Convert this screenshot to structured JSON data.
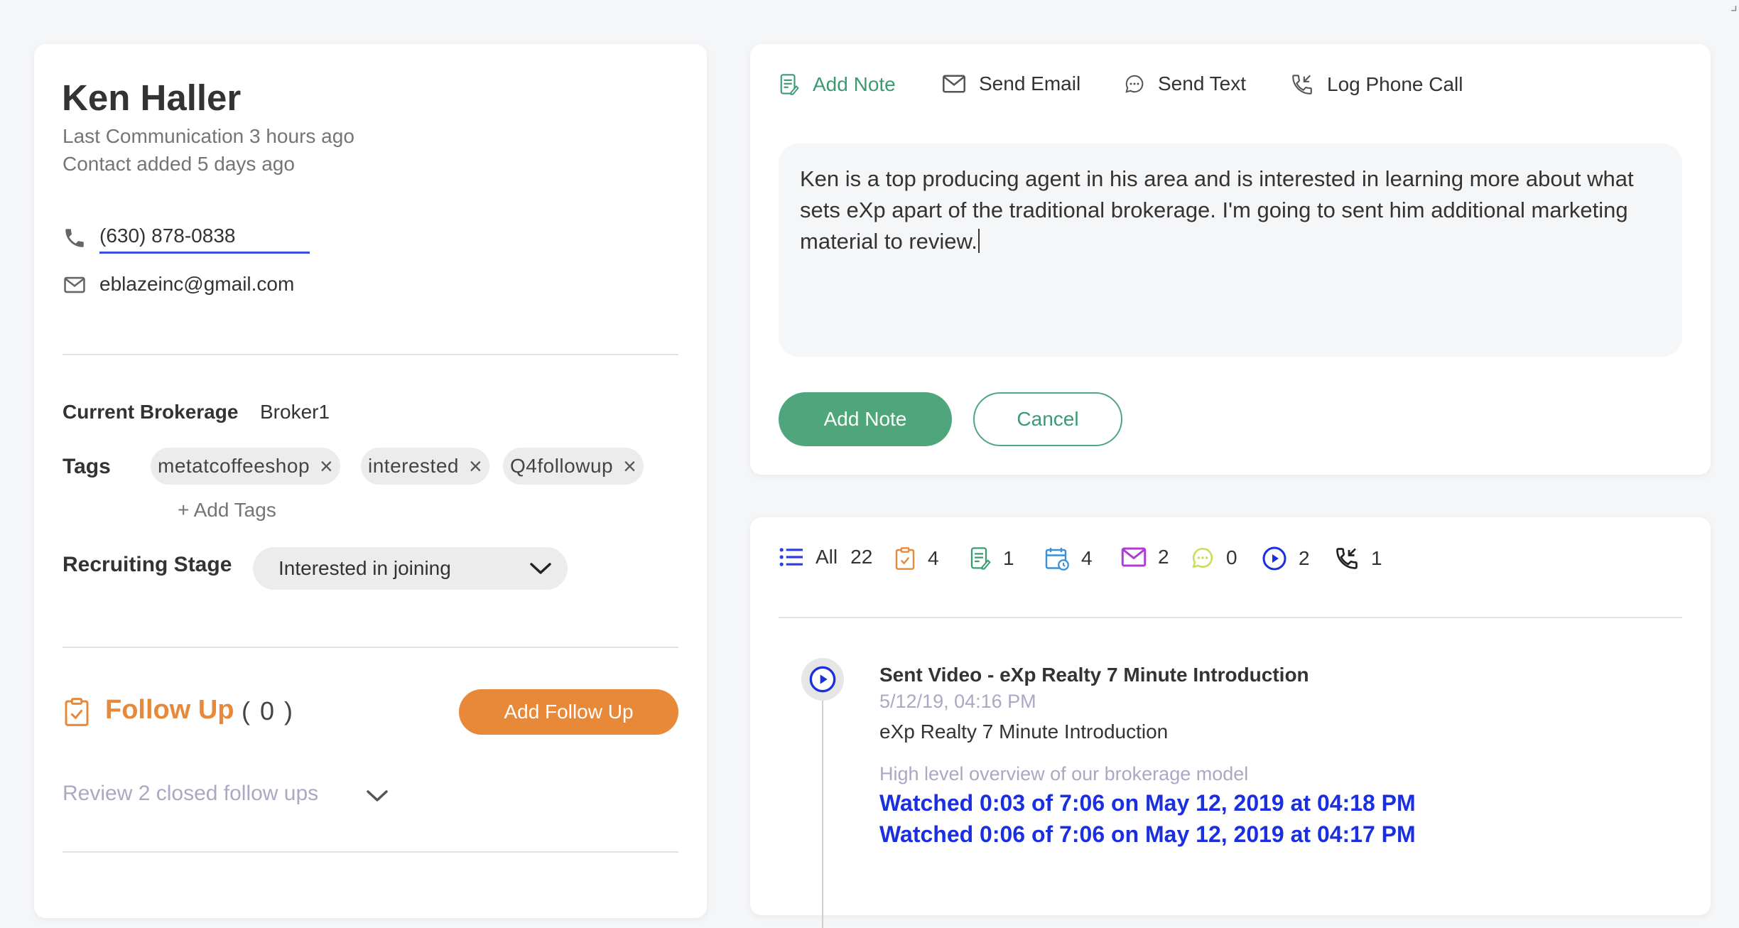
{
  "contact": {
    "name": "Ken Haller",
    "last_communication": "Last Communication 3 hours ago",
    "contact_added": "Contact added 5 days ago",
    "phone": "(630) 878-0838",
    "email": "eblazeinc@gmail.com"
  },
  "details": {
    "brokerage_label": "Current Brokerage",
    "brokerage_value": "Broker1",
    "tags_label": "Tags",
    "tags": [
      "metatcoffeeshop",
      "interested",
      "Q4followup"
    ],
    "tag_remove_glyph": "×",
    "add_tags": "+ Add Tags",
    "stage_label": "Recruiting Stage",
    "stage_value": "Interested in joining"
  },
  "follow_up": {
    "title": "Follow Up",
    "count": "( 0 )",
    "add_button": "Add Follow Up",
    "review": "Review 2 closed follow ups"
  },
  "composer": {
    "tabs": [
      {
        "label": "Add Note",
        "icon": "note-icon",
        "active": true
      },
      {
        "label": "Send Email",
        "icon": "email-icon",
        "active": false
      },
      {
        "label": "Send Text",
        "icon": "chat-bubble-icon",
        "active": false
      },
      {
        "label": "Log Phone Call",
        "icon": "phone-call-icon",
        "active": false
      }
    ],
    "note_text": "Ken is a top producing agent in his area and is interested in learning more about what sets eXp apart of the traditional brokerage. I'm going to sent him additional marketing material to review.",
    "add_button": "Add Note",
    "cancel_button": "Cancel"
  },
  "activity": {
    "filters": [
      {
        "icon": "list-icon",
        "label": "All",
        "count": "22",
        "color": "#2b3fe0"
      },
      {
        "icon": "clipboard-check-icon",
        "label": "",
        "count": "4",
        "color": "#e8893a"
      },
      {
        "icon": "note-icon",
        "label": "",
        "count": "1",
        "color": "#3a9b73"
      },
      {
        "icon": "calendar-clock-icon",
        "label": "",
        "count": "4",
        "color": "#3b8fd6"
      },
      {
        "icon": "envelope-icon",
        "label": "",
        "count": "2",
        "color": "#b03ad6"
      },
      {
        "icon": "chat-bubble-icon",
        "label": "",
        "count": "0",
        "color": "#cbdc5a"
      },
      {
        "icon": "play-circle-icon",
        "label": "",
        "count": "2",
        "color": "#1a2fe0"
      },
      {
        "icon": "phone-call-icon",
        "label": "",
        "count": "1",
        "color": "#222222"
      }
    ],
    "event": {
      "title": "Sent Video - eXp Realty 7 Minute Introduction",
      "date": "5/12/19, 04:16 PM",
      "name": "eXp Realty 7 Minute Introduction",
      "description": "High level overview of our brokerage model",
      "watched": [
        "Watched 0:03 of 7:06 on May 12, 2019 at 04:18 PM",
        "Watched 0:06 of 7:06 on May 12, 2019 at 04:17 PM"
      ]
    }
  },
  "colors": {
    "accent_green": "#4fa67d",
    "accent_orange": "#e8893a",
    "link_blue": "#1a2fe0",
    "muted_lavender": "#a9a9c4"
  }
}
